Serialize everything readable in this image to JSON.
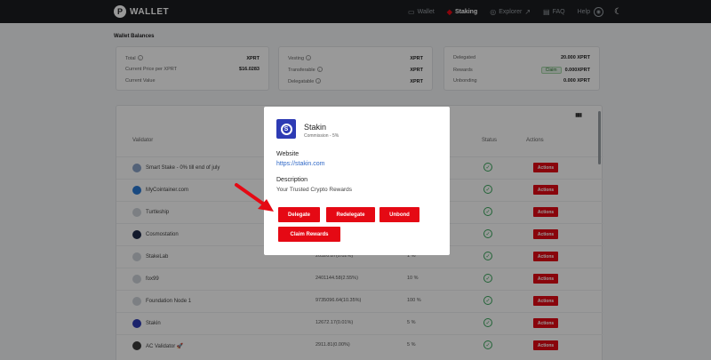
{
  "navbar": {
    "brand": "WALLET",
    "items": [
      {
        "label": "Wallet",
        "icon": "wallet-icon"
      },
      {
        "label": "Staking",
        "icon": "staking-icon",
        "active": true
      },
      {
        "label": "Explorer",
        "icon": "explorer-icon"
      },
      {
        "label": "FAQ",
        "icon": "faq-icon"
      },
      {
        "label": "Help"
      }
    ]
  },
  "page_title": "Wallet Balances",
  "balances": {
    "total_label": "Total",
    "total_value": "XPRT",
    "price_label": "Current Price per XPRT",
    "price_value": "$16.0283",
    "current_value_label": "Current Value"
  },
  "vesting": {
    "vesting_label": "Vesting",
    "vesting_value": "XPRT",
    "transferable_label": "Transferable",
    "transferable_value": "XPRT",
    "delegatable_label": "Delegatable",
    "delegatable_value": "XPRT"
  },
  "delegation": {
    "delegated_label": "Delegated",
    "delegated_value": "20.000 XPRT",
    "rewards_label": "Rewards",
    "claim_label": "Claim",
    "rewards_value": "0.000XPRT",
    "unbonding_label": "Unbonding",
    "unbonding_value": "0.000 XPRT"
  },
  "table": {
    "headers": {
      "validator": "Validator",
      "status": "Status",
      "actions": "Actions"
    },
    "action_label": "Actions",
    "rows": [
      {
        "name": "Smart Stake - 0% till end of july",
        "voting_power": "",
        "commission": ""
      },
      {
        "name": "MyCointainer.com",
        "voting_power": "",
        "commission": ""
      },
      {
        "name": "Turtleship",
        "voting_power": "",
        "commission": ""
      },
      {
        "name": "Cosmostation",
        "voting_power": "",
        "commission": ""
      },
      {
        "name": "StakeLab",
        "voting_power": "20320.87(0.02%)",
        "commission": "1 %"
      },
      {
        "name": "fox99",
        "voting_power": "2401144.58(2.55%)",
        "commission": "10 %"
      },
      {
        "name": "Foundation Node 1",
        "voting_power": "9735096.64(10.35%)",
        "commission": "100 %"
      },
      {
        "name": "Stakin",
        "voting_power": "12672.17(0.01%)",
        "commission": "5 %"
      },
      {
        "name": "AC Validator 🚀",
        "voting_power": "2911.81(0.00%)",
        "commission": "5 %"
      }
    ]
  },
  "modal": {
    "name": "Stakin",
    "commission": "Commission - 5%",
    "website_label": "Website",
    "website_url": "https://stakin.com",
    "description_label": "Description",
    "description": "Your Trusted Crypto Rewards",
    "buttons": {
      "delegate": "Delegate",
      "redelegate": "Redelegate",
      "unbond": "Unbond",
      "claim_rewards": "Claim Rewards"
    }
  },
  "colors": {
    "accent": "#e50914",
    "navbar": "#1b1d21",
    "link": "#2f68c7",
    "status": "#37a55a"
  }
}
